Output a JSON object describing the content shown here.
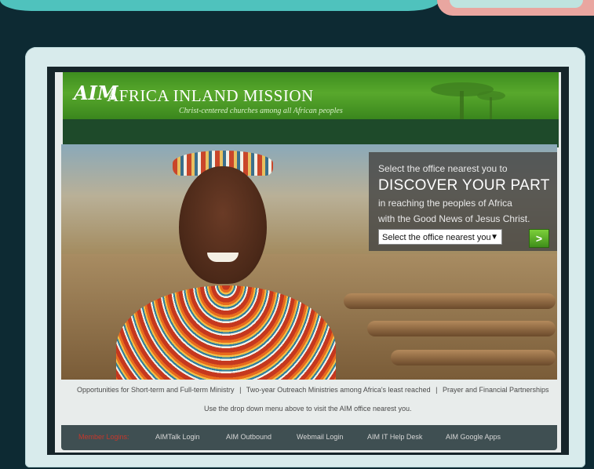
{
  "header": {
    "logo_text": "AIM",
    "brand": "AFRICA INLAND MISSION",
    "tagline": "Christ-centered churches among all African peoples"
  },
  "cta": {
    "line1": "Select the office nearest you to",
    "line2": "DISCOVER YOUR PART",
    "line3": "in reaching the peoples of Africa",
    "line4": "with the Good News of Jesus Christ.",
    "select_value": "Select the office nearest you",
    "go_label": ">"
  },
  "links": [
    "Opportunities for Short-term and Full-term Ministry",
    "|",
    "Two-year Outreach Ministries among Africa's least reached",
    "|",
    "Prayer and Financial Partnerships"
  ],
  "sub_note": "Use the drop down menu above to visit the AIM office nearest you.",
  "footer": {
    "items": [
      "Member Logins:",
      "AIMTalk Login",
      "AIM Outbound",
      "Webmail Login",
      "AIM IT Help Desk",
      "AIM Google Apps"
    ]
  },
  "colors": {
    "header_green": "#58a82c",
    "footer_bg": "#3f4f52",
    "member_logins": "#c7372b"
  }
}
